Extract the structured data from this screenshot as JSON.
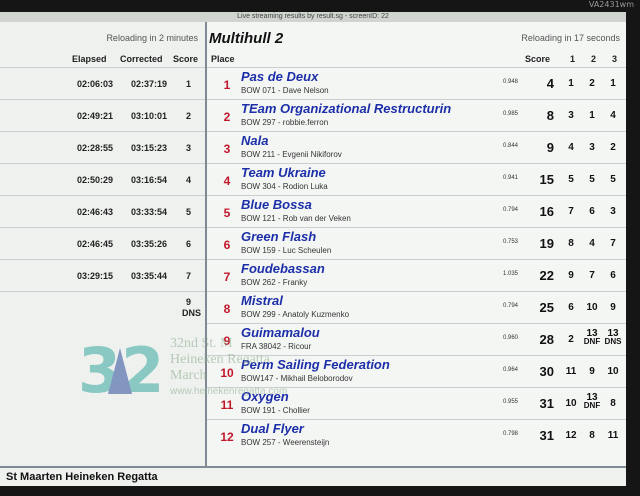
{
  "bezel": {
    "brand": "VA2431wm"
  },
  "topbar": {
    "text": "Live streaming results by result.sg - screenID: 22"
  },
  "left": {
    "reload": "Reloading in 2 minutes",
    "headers": {
      "elapsed": "Elapsed",
      "corrected": "Corrected",
      "score": "Score"
    },
    "rows": [
      {
        "elapsed": "02:06:03",
        "corrected": "02:37:19",
        "score": "1"
      },
      {
        "elapsed": "02:49:21",
        "corrected": "03:10:01",
        "score": "2"
      },
      {
        "elapsed": "02:28:55",
        "corrected": "03:15:23",
        "score": "3"
      },
      {
        "elapsed": "02:50:29",
        "corrected": "03:16:54",
        "score": "4"
      },
      {
        "elapsed": "02:46:43",
        "corrected": "03:33:54",
        "score": "5"
      },
      {
        "elapsed": "02:46:45",
        "corrected": "03:35:26",
        "score": "6"
      },
      {
        "elapsed": "03:29:15",
        "corrected": "03:35:44",
        "score": "7"
      },
      {
        "elapsed": "",
        "corrected": "",
        "score": "9",
        "penalty": "DNS"
      }
    ]
  },
  "right": {
    "class_title": "Multihull 2",
    "reload": "Reloading in 17 seconds",
    "headers": {
      "place": "Place",
      "score": "Score",
      "r1": "1",
      "r2": "2",
      "r3": "3"
    },
    "rows": [
      {
        "place": "1",
        "name": "Pas de Deux",
        "bow": "BOW 071 - Dave Nelson",
        "rating": "0.948",
        "total": "4",
        "r1": "1",
        "r2": "2",
        "r3": "1"
      },
      {
        "place": "2",
        "name": "TEam Organizational Restructurin",
        "bow": "BOW 297 - robbie.ferron",
        "rating": "0.985",
        "total": "8",
        "r1": "3",
        "r2": "1",
        "r3": "4"
      },
      {
        "place": "3",
        "name": "Nala",
        "bow": "BOW 211 - Evgenii Nikiforov",
        "rating": "0.844",
        "total": "9",
        "r1": "4",
        "r2": "3",
        "r3": "2"
      },
      {
        "place": "4",
        "name": "Team Ukraine",
        "bow": "BOW 304 - Rodion Luka",
        "rating": "0.941",
        "total": "15",
        "r1": "5",
        "r2": "5",
        "r3": "5"
      },
      {
        "place": "5",
        "name": "Blue Bossa",
        "bow": "BOW 121 - Rob van der Veken",
        "rating": "0.794",
        "total": "16",
        "r1": "7",
        "r2": "6",
        "r3": "3"
      },
      {
        "place": "6",
        "name": "Green Flash",
        "bow": "BOW 159 - Luc Scheulen",
        "rating": "0.753",
        "total": "19",
        "r1": "8",
        "r2": "4",
        "r3": "7"
      },
      {
        "place": "7",
        "name": "Foudebassan",
        "bow": "BOW 262 - Franky",
        "rating": "1.035",
        "total": "22",
        "r1": "9",
        "r2": "7",
        "r3": "6"
      },
      {
        "place": "8",
        "name": "Mistral",
        "bow": "BOW 299 - Anatoly Kuzmenko",
        "rating": "0.794",
        "total": "25",
        "r1": "6",
        "r2": "10",
        "r3": "9"
      },
      {
        "place": "9",
        "name": "Guimamalou",
        "bow": "FRA 38042 - Ricour",
        "rating": "0.960",
        "total": "28",
        "r1": "2",
        "r2": "13",
        "r2_pen": "DNF",
        "r3": "13",
        "r3_pen": "DNS"
      },
      {
        "place": "10",
        "name": "Perm Sailing Federation",
        "bow": "BOW147 - Mikhail Beloborodov",
        "rating": "0.964",
        "total": "30",
        "r1": "11",
        "r2": "9",
        "r3": "10"
      },
      {
        "place": "11",
        "name": "Oxygen",
        "bow": "BOW 191 - Chollier",
        "rating": "0.955",
        "total": "31",
        "r1": "10",
        "r2": "13",
        "r2_pen": "DNF",
        "r3": "8"
      },
      {
        "place": "12",
        "name": "Dual Flyer",
        "bow": "BOW 257 - Weerensteijn",
        "rating": "0.798",
        "total": "31",
        "r1": "12",
        "r2": "8",
        "r3": "11"
      }
    ]
  },
  "logo": {
    "number": "32",
    "line1": "32nd St. M",
    "line2": "Heineken Regatta",
    "line3": "March",
    "url": "www.heinekenregatta.com"
  },
  "footer": {
    "title": "St Maarten Heineken Regatta"
  }
}
